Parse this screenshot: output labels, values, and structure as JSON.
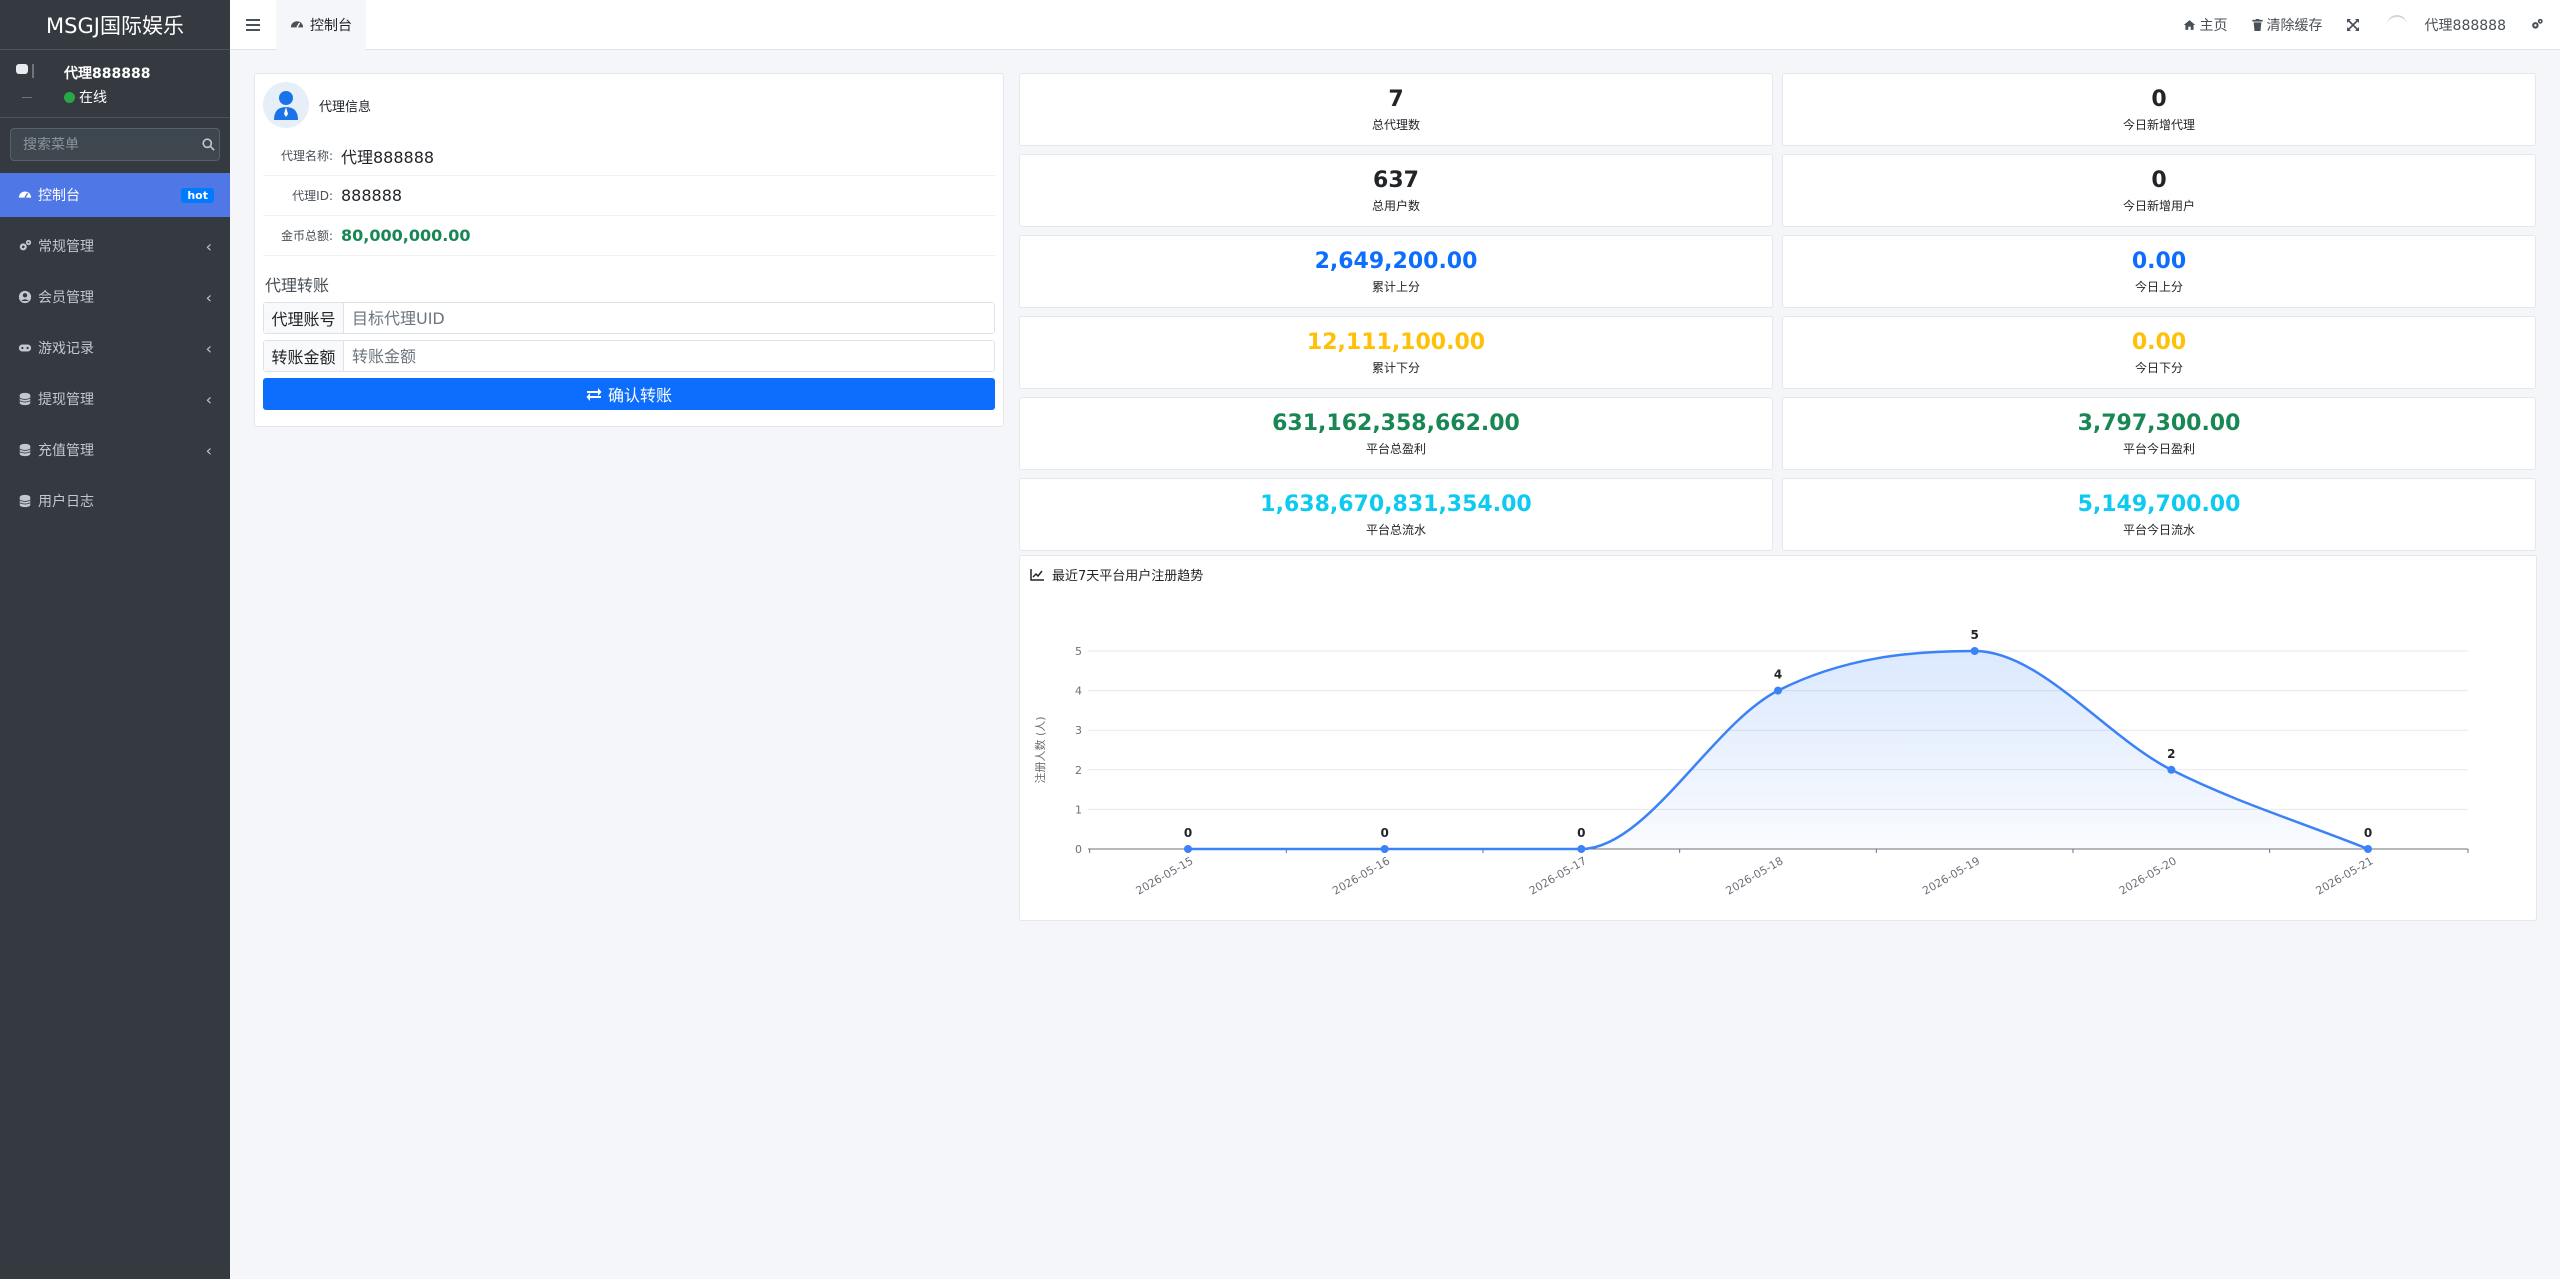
{
  "sidebar": {
    "brand": "MSGJ国际娱乐",
    "user": {
      "name": "代理888888",
      "status": "在线"
    },
    "search_placeholder": "搜索菜单",
    "items": [
      {
        "label": "控制台",
        "badge": "hot"
      },
      {
        "label": "常规管理"
      },
      {
        "label": "会员管理"
      },
      {
        "label": "游戏记录"
      },
      {
        "label": "提现管理"
      },
      {
        "label": "充值管理"
      },
      {
        "label": "用户日志"
      }
    ]
  },
  "navbar": {
    "tab": "控制台",
    "home": "主页",
    "clear_cache": "清除缓存",
    "user": "代理888888"
  },
  "agent": {
    "title": "代理信息",
    "name_label": "代理名称:",
    "name": "代理888888",
    "id_label": "代理ID:",
    "id": "888888",
    "coins_label": "金币总额:",
    "coins": "80,000,000.00",
    "transfer_title": "代理转账",
    "account_label": "代理账号",
    "account_placeholder": "目标代理UID",
    "amount_label": "转账金额",
    "amount_placeholder": "转账金额",
    "confirm": "确认转账"
  },
  "stats": [
    {
      "value": "7",
      "caption": "总代理数",
      "color": "#212529"
    },
    {
      "value": "0",
      "caption": "今日新增代理",
      "color": "#212529"
    },
    {
      "value": "637",
      "caption": "总用户数",
      "color": "#212529"
    },
    {
      "value": "0",
      "caption": "今日新增用户",
      "color": "#212529"
    },
    {
      "value": "2,649,200.00",
      "caption": "累计上分",
      "color": "#0d6efd"
    },
    {
      "value": "0.00",
      "caption": "今日上分",
      "color": "#0d6efd"
    },
    {
      "value": "12,111,100.00",
      "caption": "累计下分",
      "color": "#ffc107"
    },
    {
      "value": "0.00",
      "caption": "今日下分",
      "color": "#ffc107"
    },
    {
      "value": "631,162,358,662.00",
      "caption": "平台总盈利",
      "color": "#198754"
    },
    {
      "value": "3,797,300.00",
      "caption": "平台今日盈利",
      "color": "#198754"
    },
    {
      "value": "1,638,670,831,354.00",
      "caption": "平台总流水",
      "color": "#0dcaf0"
    },
    {
      "value": "5,149,700.00",
      "caption": "平台今日流水",
      "color": "#0dcaf0"
    }
  ],
  "chart_title": "最近7天平台用户注册趋势",
  "chart_data": {
    "type": "area",
    "title": "最近7天平台用户注册趋势",
    "x": [
      "2026-05-15",
      "2026-05-16",
      "2026-05-17",
      "2026-05-18",
      "2026-05-19",
      "2026-05-20",
      "2026-05-21"
    ],
    "series": [
      {
        "values": [
          0,
          0,
          0,
          4,
          5,
          2,
          0
        ]
      }
    ],
    "ylabel": "注册人数 (人)",
    "xlabel": "",
    "ylim": [
      0,
      5
    ],
    "yticks": [
      0,
      1,
      2,
      3,
      4,
      5
    ],
    "grid": true,
    "smooth": true,
    "color": "#3b82f6"
  }
}
